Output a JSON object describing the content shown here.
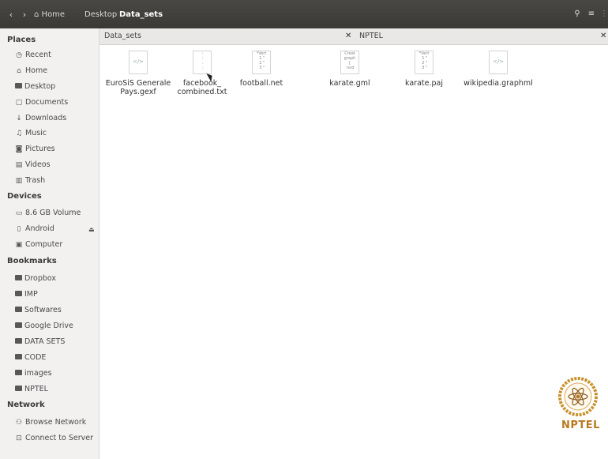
{
  "toolbar": {
    "back_icon": "chevron-left",
    "forward_icon": "chevron-right",
    "breadcrumbs": [
      {
        "label": "Home",
        "icon": "home-icon"
      },
      {
        "label": "Desktop"
      },
      {
        "label": "Data_sets"
      }
    ],
    "search_icon": "search-icon",
    "menu_icon": "hamburger-icon"
  },
  "sidebar": {
    "places_title": "Places",
    "places": [
      {
        "label": "Recent",
        "icon": "clock-icon"
      },
      {
        "label": "Home",
        "icon": "home-icon"
      },
      {
        "label": "Desktop",
        "icon": "folder-icon"
      },
      {
        "label": "Documents",
        "icon": "document-icon"
      },
      {
        "label": "Downloads",
        "icon": "download-icon"
      },
      {
        "label": "Music",
        "icon": "music-icon"
      },
      {
        "label": "Pictures",
        "icon": "camera-icon"
      },
      {
        "label": "Videos",
        "icon": "film-icon"
      },
      {
        "label": "Trash",
        "icon": "trash-icon"
      }
    ],
    "devices_title": "Devices",
    "devices": [
      {
        "label": "8.6 GB Volume",
        "icon": "drive-icon"
      },
      {
        "label": "Android",
        "icon": "phone-icon"
      },
      {
        "label": "Computer",
        "icon": "computer-icon"
      }
    ],
    "bookmarks_title": "Bookmarks",
    "bookmarks": [
      {
        "label": "Dropbox"
      },
      {
        "label": "IMP"
      },
      {
        "label": "Softwares"
      },
      {
        "label": "Google Drive"
      },
      {
        "label": "DATA SETS"
      },
      {
        "label": "CODE"
      },
      {
        "label": "images"
      },
      {
        "label": "NPTEL"
      }
    ],
    "network_title": "Network",
    "network": [
      {
        "label": "Browse Network",
        "icon": "network-icon"
      },
      {
        "label": "Connect to Server",
        "icon": "server-icon"
      }
    ]
  },
  "tabs": [
    {
      "label": "Data_sets",
      "active": true
    },
    {
      "label": "NPTEL",
      "active": false
    }
  ],
  "files": [
    {
      "name_line1": "EuroSiS Generale",
      "name_line2": "Pays.gexf",
      "icon": "code-file-icon"
    },
    {
      "name_line1": "facebook_",
      "name_line2": "combined.txt",
      "icon": "text-file-icon"
    },
    {
      "name_line1": "football.net",
      "name_line2": "",
      "icon": "text-file-icon"
    },
    {
      "name_line1": "karate.gml",
      "name_line2": "",
      "icon": "text-file-icon"
    },
    {
      "name_line1": "karate.paj",
      "name_line2": "",
      "icon": "text-file-icon"
    },
    {
      "name_line1": "wikipedia.graphml",
      "name_line2": "",
      "icon": "code-file-icon"
    }
  ],
  "logo": {
    "text": "NPTEL",
    "color": "#b7791f"
  }
}
